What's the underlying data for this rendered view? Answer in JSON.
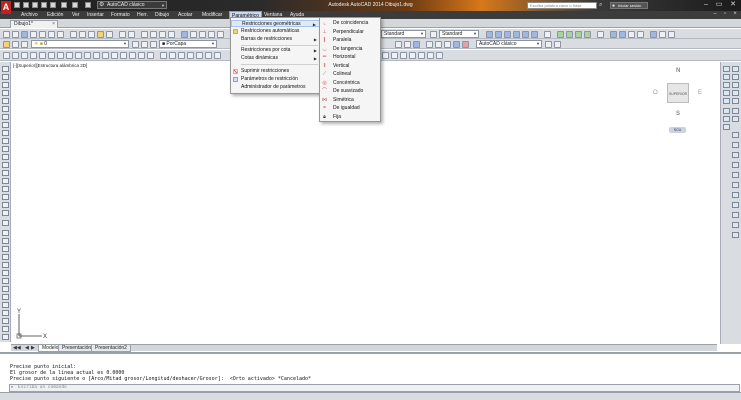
{
  "titlebar": {
    "workspace": "AutoCAD clásico",
    "title": "Autodesk AutoCAD 2014   Dibujo1.dwg",
    "search_placeholder": "Escriba palabra clave o frase",
    "login": "Iniciar sesión"
  },
  "menubar": {
    "items": [
      "Archivo",
      "Edición",
      "Ver",
      "Insertar",
      "Formato",
      "Herr.",
      "Dibujo",
      "Acotar",
      "Modificar",
      "Paramétrico",
      "Ventana",
      "Ayuda"
    ]
  },
  "document_tab": {
    "label": "Dibujo1*"
  },
  "toolbars": {
    "textstyle": "Standard",
    "dimstyle": "Standard",
    "layer": "0",
    "color": "PorCapa",
    "workspace2": "AutoCAD clásico"
  },
  "viewport": {
    "label": "[-][Superior][Estructura alámbrica 2D]",
    "viewcube": {
      "north": "N",
      "south": "S",
      "west": "O",
      "east": "E",
      "face": "SUPERIOR",
      "wcs": "SCU"
    }
  },
  "layout_tabs": [
    "Modelo",
    "Presentación1",
    "Presentación2"
  ],
  "command": {
    "lines": [
      "Precise punto inicial:",
      "El grosor de la línea actual es 0.0000",
      "Precise punto siguiente o [Arco/Mitad grosor/Longitud/deshacer/Grosor]:  <Orto activado> *Cancelado*"
    ],
    "input_placeholder": "Escriba un comando"
  },
  "menu_parametrico": {
    "items": [
      "Restricciones geométricas",
      "Restricciones automáticas",
      "Barras de restricciones",
      "Restricciones por cota",
      "Cotas dinámicas",
      "Suprimir restricciones",
      "Parámetros de restricción",
      "Administrador de parámetros"
    ]
  },
  "menu_geometricas": {
    "items": [
      "De coincidencia",
      "Perpendicular",
      "Paralela",
      "De tangencia",
      "Horizontal",
      "Vertical",
      "Colineal",
      "Concéntrica",
      "De suavizado",
      "Simétrica",
      "De igualdad",
      "Fija"
    ]
  },
  "colors": {
    "accent": "#d8781a",
    "menu_highlight": "#dfe9f8",
    "logo": "#c42020"
  }
}
